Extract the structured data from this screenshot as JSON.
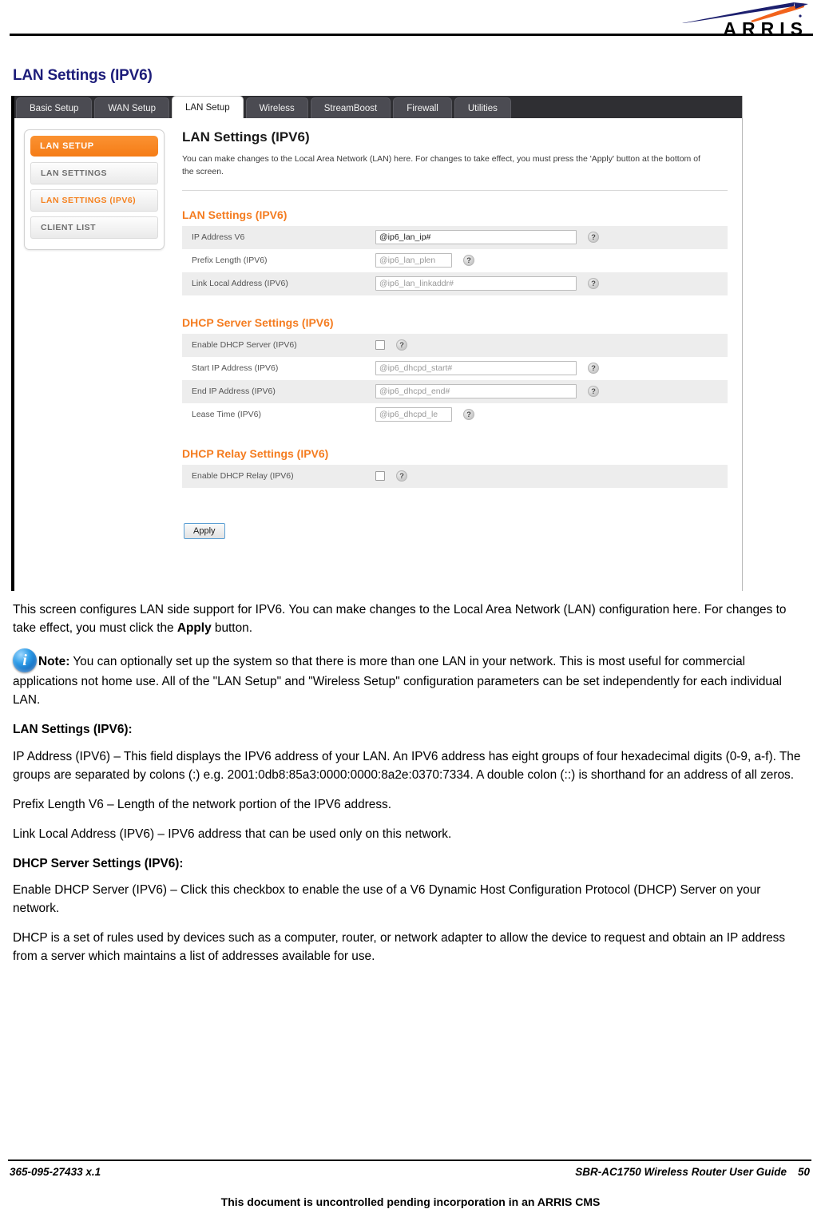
{
  "brand": {
    "name": "ARRIS",
    "logo_icon": "arris-swoosh-logo",
    "swoosh_navy": "#1c1f6e",
    "swoosh_orange": "#f2631c"
  },
  "document": {
    "title": "LAN Settings (IPV6)",
    "title_color": "#1d1d7a"
  },
  "router_ui": {
    "tabs": [
      {
        "label": "Basic Setup",
        "active": false
      },
      {
        "label": "WAN Setup",
        "active": false
      },
      {
        "label": "LAN Setup",
        "active": true
      },
      {
        "label": "Wireless",
        "active": false
      },
      {
        "label": "StreamBoost",
        "active": false
      },
      {
        "label": "Firewall",
        "active": false
      },
      {
        "label": "Utilities",
        "active": false
      }
    ],
    "sidebar": {
      "header": "LAN SETUP",
      "items": [
        {
          "label": "LAN SETTINGS",
          "selected": false
        },
        {
          "label": "LAN SETTINGS (IPV6)",
          "selected": true
        },
        {
          "label": "CLIENT LIST",
          "selected": false
        }
      ],
      "accent_color": "#f58220"
    },
    "content": {
      "heading": "LAN Settings (IPV6)",
      "description": "You can make changes to the Local Area Network (LAN) here. For changes to take effect, you must press the 'Apply' button at the bottom of the screen.",
      "sections": [
        {
          "title": "LAN Settings (IPV6)",
          "rows": [
            {
              "label": "IP Address V6",
              "type": "text",
              "value": "@ip6_lan_ip#",
              "filled": true,
              "width": "wide",
              "help": "?"
            },
            {
              "label": "Prefix Length (IPV6)",
              "type": "text",
              "value": "@ip6_lan_plen",
              "filled": false,
              "width": "narrow",
              "help": "?"
            },
            {
              "label": "Link Local Address (IPV6)",
              "type": "text",
              "value": "@ip6_lan_linkaddr#",
              "filled": false,
              "width": "wide",
              "help": "?"
            }
          ]
        },
        {
          "title": "DHCP Server Settings (IPV6)",
          "rows": [
            {
              "label": "Enable DHCP Server (IPV6)",
              "type": "checkbox",
              "checked": false,
              "help": "?"
            },
            {
              "label": "Start IP Address (IPV6)",
              "type": "text",
              "value": "@ip6_dhcpd_start#",
              "filled": false,
              "width": "wide",
              "help": "?"
            },
            {
              "label": "End IP Address (IPV6)",
              "type": "text",
              "value": "@ip6_dhcpd_end#",
              "filled": false,
              "width": "wide",
              "help": "?"
            },
            {
              "label": "Lease Time (IPV6)",
              "type": "text",
              "value": "@ip6_dhcpd_le",
              "filled": false,
              "width": "narrow",
              "help": "?"
            }
          ]
        },
        {
          "title": "DHCP Relay Settings (IPV6)",
          "rows": [
            {
              "label": "Enable DHCP Relay (IPV6)",
              "type": "checkbox",
              "checked": false,
              "help": "?"
            }
          ]
        }
      ],
      "apply_label": "Apply"
    }
  },
  "body": {
    "intro_a": "This screen configures LAN side support for IPV6.  You can make changes to the Local Area Network (LAN) configuration here.  For changes to take effect, you must click the ",
    "intro_bold": "Apply",
    "intro_b": " button.",
    "note_label": "Note:",
    "note_text": "  You can optionally set up the system so that there is more than one LAN in your network.  This is most useful for commercial applications not home use.  All of the \"LAN Setup\" and \"Wireless Setup\" configuration parameters can be set independently for each individual LAN.",
    "head_lan": "LAN Settings (IPV6):",
    "p_ip_address": "IP Address (IPV6) – This field displays the IPV6 address of your LAN.  An IPV6 address has eight groups of four hexadecimal digits (0-9, a-f).  The groups are separated by colons (:) e.g. 2001:0db8:85a3:0000:0000:8a2e:0370:7334.  A double colon (::) is shorthand for an address of all zeros.",
    "p_prefix": "Prefix Length V6 – Length of the network portion of the IPV6 address.",
    "p_linklocal": "Link Local Address (IPV6) – IPV6 address that can be used only on this network.",
    "head_dhcp": "DHCP Server Settings (IPV6):",
    "p_enable_dhcp": "Enable DHCP Server (IPV6) – Click this checkbox to enable the use of a V6 Dynamic Host Configuration Protocol (DHCP) Server on your network.",
    "p_dhcp_rules": "DHCP is a set of rules used by devices such as a computer, router, or network adapter to allow the device to request and obtain an IP address from a server which maintains a list of addresses available for use."
  },
  "footer": {
    "doc_number": "365-095-27433 x.1",
    "guide_name": "SBR-AC1750 Wireless Router User Guide",
    "page_number": "50",
    "disclaimer": "This document is uncontrolled pending incorporation in an ARRIS CMS"
  }
}
